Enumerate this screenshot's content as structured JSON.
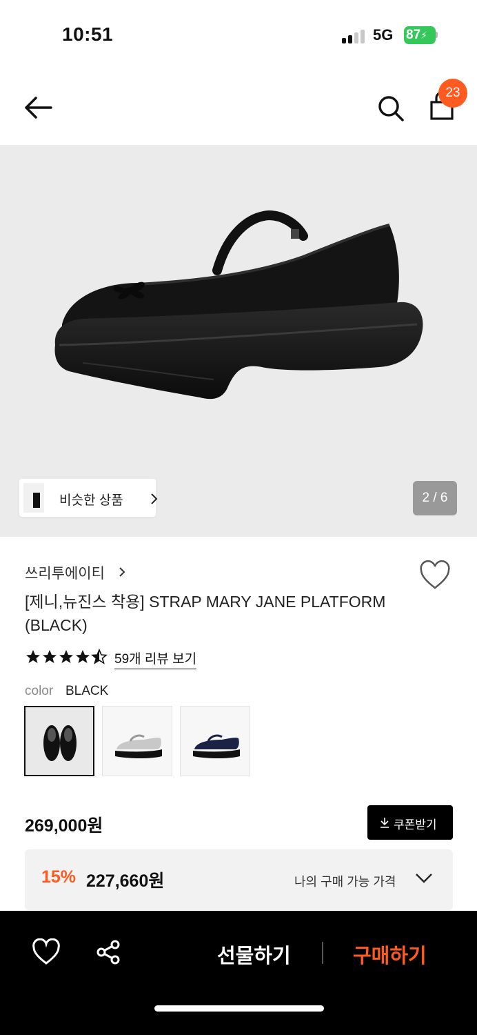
{
  "status": {
    "time": "10:51",
    "network": "5G",
    "battery": "87"
  },
  "nav": {
    "cart_count": "23",
    "icons": [
      "back-arrow-icon",
      "search-icon",
      "shopping-bag-icon"
    ]
  },
  "gallery": {
    "similar_label": "비슷한 상품",
    "page_indicator": "2 / 6",
    "background": "#ebebeb"
  },
  "product": {
    "brand": "쓰리투에이티",
    "title": "[제니,뉴진스 착용] STRAP MARY JANE PLATFORM (BLACK)",
    "rating": 4.5,
    "review_link": "59개 리뷰 보기",
    "color_label": "color",
    "color_value": "BLACK",
    "colors": [
      "BLACK",
      "SILVER",
      "NAVY"
    ],
    "price": "269,000원",
    "coupon_label": "쿠폰받기",
    "discount": "15%",
    "sale_price": "227,660원",
    "my_price_label": "나의 구매 가능 가격"
  },
  "bottom_bar": {
    "gift_label": "선물하기",
    "buy_label": "구매하기",
    "accent": "#ff5a1f"
  }
}
